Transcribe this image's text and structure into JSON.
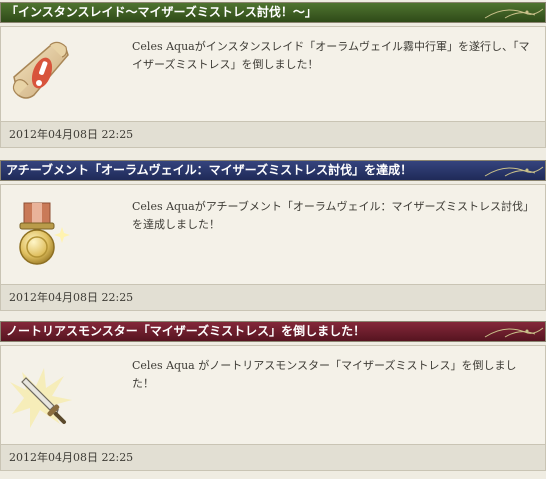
{
  "entries": [
    {
      "title": "「インスタンスレイド～マイザーズミストレス討伐！～」",
      "header_color": "#3e5e22",
      "icon": "scroll-exclamation-icon",
      "message": "Celes Aquaがインスタンスレイド「オーラムヴェイル霧中行軍」を遂行し、「マイザーズミストレス」を倒しました！",
      "timestamp": "2012年04月08日  22:25"
    },
    {
      "title": "アチーブメント「オーラムヴェイル：マイザーズミストレス討伐」を達成！",
      "header_color": "#27346a",
      "icon": "medal-icon",
      "message": "Celes Aquaがアチーブメント「オーラムヴェイル：マイザーズミストレス討伐」を達成しました！",
      "timestamp": "2012年04月08日  22:25"
    },
    {
      "title": "ノートリアスモンスター「マイザーズミストレス」を倒しました！",
      "header_color": "#6b1d2a",
      "icon": "sword-icon",
      "message": "Celes Aqua がノートリアスモンスター「マイザーズミストレス」を倒しました！",
      "timestamp": "2012年04月08日  22:25"
    }
  ]
}
